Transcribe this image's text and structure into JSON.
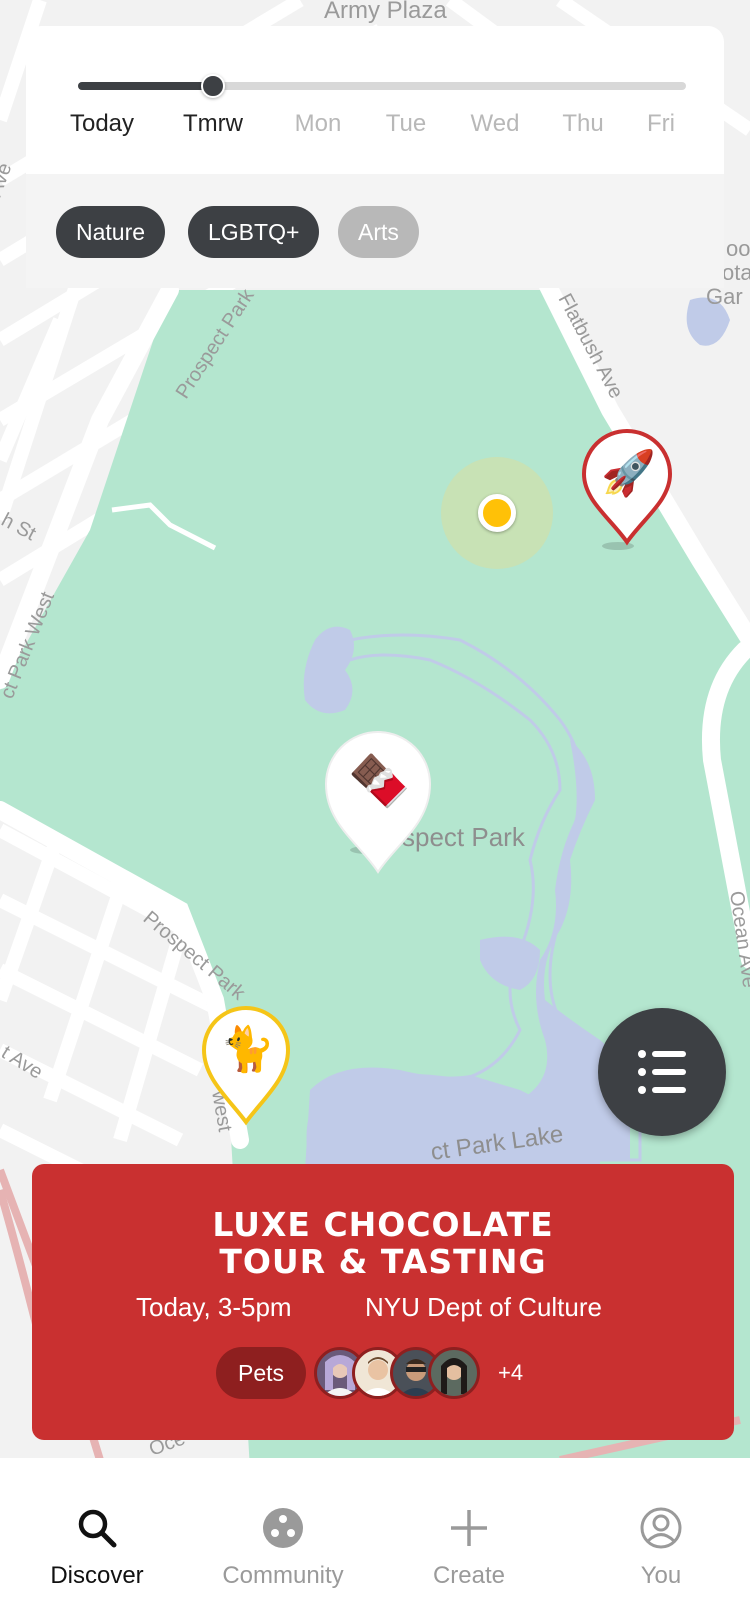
{
  "map": {
    "labels": {
      "army_plaza": "Army Plaza",
      "prospect_park_road_1": "Prospect Park",
      "flatbush_ave": "Flatbush Ave",
      "prospect_park_west": "ct Park West",
      "park_name": "spect Park",
      "prospect_park_sw": "Prospect Park",
      "sw_suffix": "west",
      "ocean_ave": "Ocean Ave",
      "lake": "ct Park Lake",
      "st_fragment": "h St",
      "ave_fragment_top": "Ave",
      "ave_fragment_bottom": "t Ave",
      "botanic_1": "oo",
      "botanic_2": "ota",
      "botanic_3": "Gar",
      "oce_fragment": "Oce"
    },
    "pins": [
      {
        "name": "rocket",
        "emoji": "🚀",
        "color": "#c93030"
      },
      {
        "name": "chocolate",
        "emoji": "🍫",
        "color": "#ffffff"
      },
      {
        "name": "cat",
        "emoji": "🐈",
        "color": "#f5c518"
      }
    ]
  },
  "date_slider": {
    "days": [
      "Today",
      "Tmrw",
      "Mon",
      "Tue",
      "Wed",
      "Thu",
      "Fri"
    ],
    "selected": "Tmrw"
  },
  "filters": [
    {
      "label": "Nature",
      "active": true
    },
    {
      "label": "LGBTQ+",
      "active": true
    },
    {
      "label": "Arts",
      "active": false
    }
  ],
  "event_card": {
    "title_line1": "LUXE CHOCOLATE",
    "title_line2": "TOUR &  TASTING",
    "time": "Today, 3-5pm",
    "host": "NYU Dept of Culture",
    "tag": "Pets",
    "extra_attendees": "+4",
    "color": "#c93030"
  },
  "list_button_icon": "list-icon",
  "nav": {
    "items": [
      {
        "label": "Discover",
        "icon": "search-icon",
        "active": true
      },
      {
        "label": "Community",
        "icon": "community-icon",
        "active": false
      },
      {
        "label": "Create",
        "icon": "plus-icon",
        "active": false
      },
      {
        "label": "You",
        "icon": "user-icon",
        "active": false
      }
    ]
  }
}
